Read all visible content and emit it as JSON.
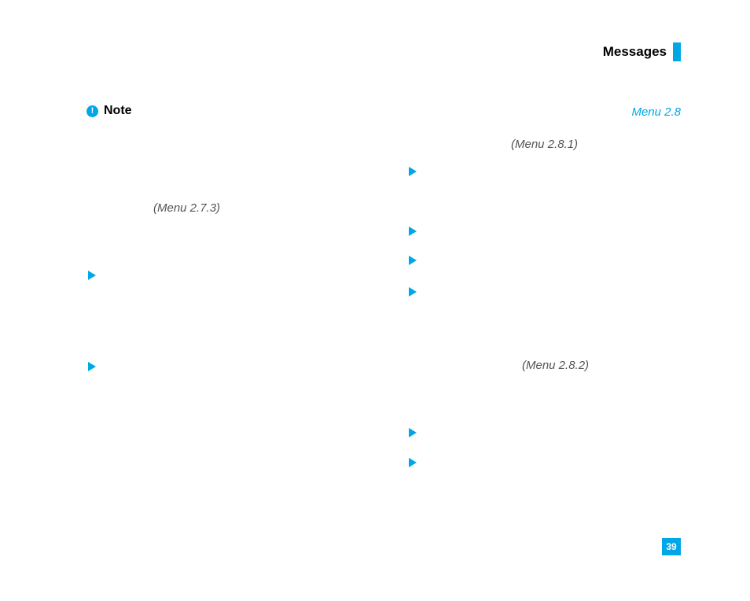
{
  "header": {
    "title": "Messages"
  },
  "pageNumber": "39",
  "note": {
    "label": "Note",
    "glyph": "!"
  },
  "menuRefs": {
    "left273": "(Menu 2.7.3)",
    "right28": "Menu 2.8",
    "right281": "(Menu 2.8.1)",
    "right282": "(Menu 2.8.2)"
  }
}
